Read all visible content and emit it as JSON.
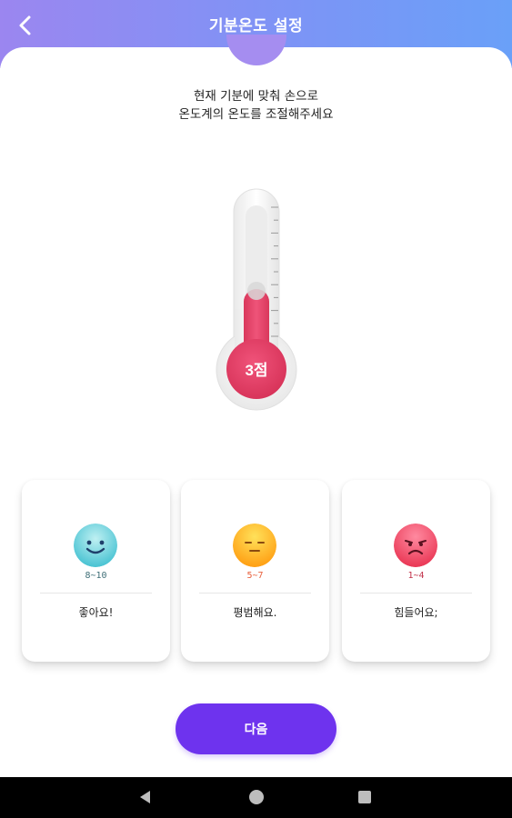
{
  "header": {
    "title": "기분온도 설정",
    "back_icon": "chevron-left-icon"
  },
  "instruction": {
    "line1": "현재 기분에 맞춰 손으로",
    "line2": "온도계의 온도를 조절해주세요"
  },
  "thermometer": {
    "score_label": "3점",
    "fill_fraction": 0.3,
    "accent": "#e8466e"
  },
  "moods": [
    {
      "range": "8~10",
      "label": "좋아요!",
      "icon": "smiling-face-icon",
      "color": "#4dc8d6",
      "range_color": "#3f6f77"
    },
    {
      "range": "5~7",
      "label": "평범해요.",
      "icon": "neutral-face-icon",
      "color": "#ffb21a",
      "range_color": "#e8603c"
    },
    {
      "range": "1~4",
      "label": "힘들어요;",
      "icon": "sad-face-icon",
      "color": "#f24666",
      "range_color": "#c2324a"
    }
  ],
  "next_button": {
    "label": "다음",
    "color": "#6e33ee"
  },
  "system_nav": {
    "back": "back-triangle-icon",
    "home": "home-circle-icon",
    "recents": "recents-square-icon"
  }
}
